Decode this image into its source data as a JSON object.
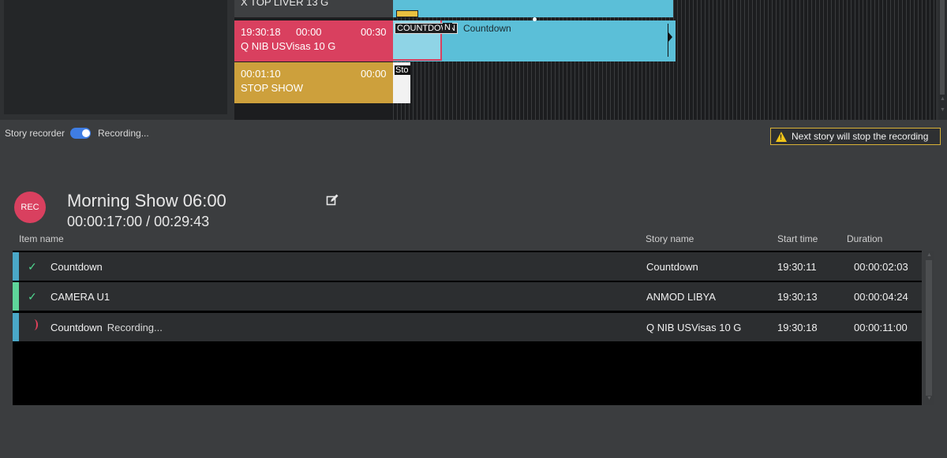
{
  "timeline": {
    "stories": [
      {
        "title": "X TOP LIVER 13 G"
      },
      {
        "start": "19:30:18",
        "elapsed": "00:00",
        "duration": "00:30",
        "title": "Q NIB USVisas 10 G"
      },
      {
        "start": "00:01:10",
        "duration": "00:00",
        "title": "STOP SHOW"
      }
    ],
    "clips": {
      "countdown_tag_1": "COUNTDOWN",
      "countdown_tag_2": "N",
      "countdown_label": "Countdown",
      "stop_label": "Sto"
    }
  },
  "recorder": {
    "label": "Story recorder",
    "enabled": true,
    "status": "Recording...",
    "warning": "Next story will stop the recording"
  },
  "show": {
    "badge": "REC",
    "title": "Morning Show 06:00",
    "time": "00:00:17:00 / 00:29:43"
  },
  "table": {
    "headers": {
      "item": "Item name",
      "story": "Story name",
      "start": "Start time",
      "duration": "Duration"
    },
    "rows": [
      {
        "item": "Countdown",
        "status": "done",
        "recording": "",
        "story": "Countdown",
        "start": "19:30:11",
        "duration": "00:00:02:03",
        "color": "#4aa8c8"
      },
      {
        "item": "CAMERA U1",
        "status": "done",
        "recording": "",
        "story": "ANMOD LIBYA",
        "start": "19:30:13",
        "duration": "00:00:04:24",
        "color": "#5ed69a"
      },
      {
        "item": "Countdown",
        "status": "recording",
        "recording": "Recording...",
        "story": "Q NIB USVisas 10 G",
        "start": "19:30:18",
        "duration": "00:00:11:00",
        "color": "#4aa8c8"
      }
    ]
  },
  "colors": {
    "rec_red": "#d9405f",
    "story_yellow": "#cda03c",
    "clip_cyan": "#5bbfd8",
    "toggle_blue": "#3f7de3",
    "check_green": "#4fd68f"
  }
}
